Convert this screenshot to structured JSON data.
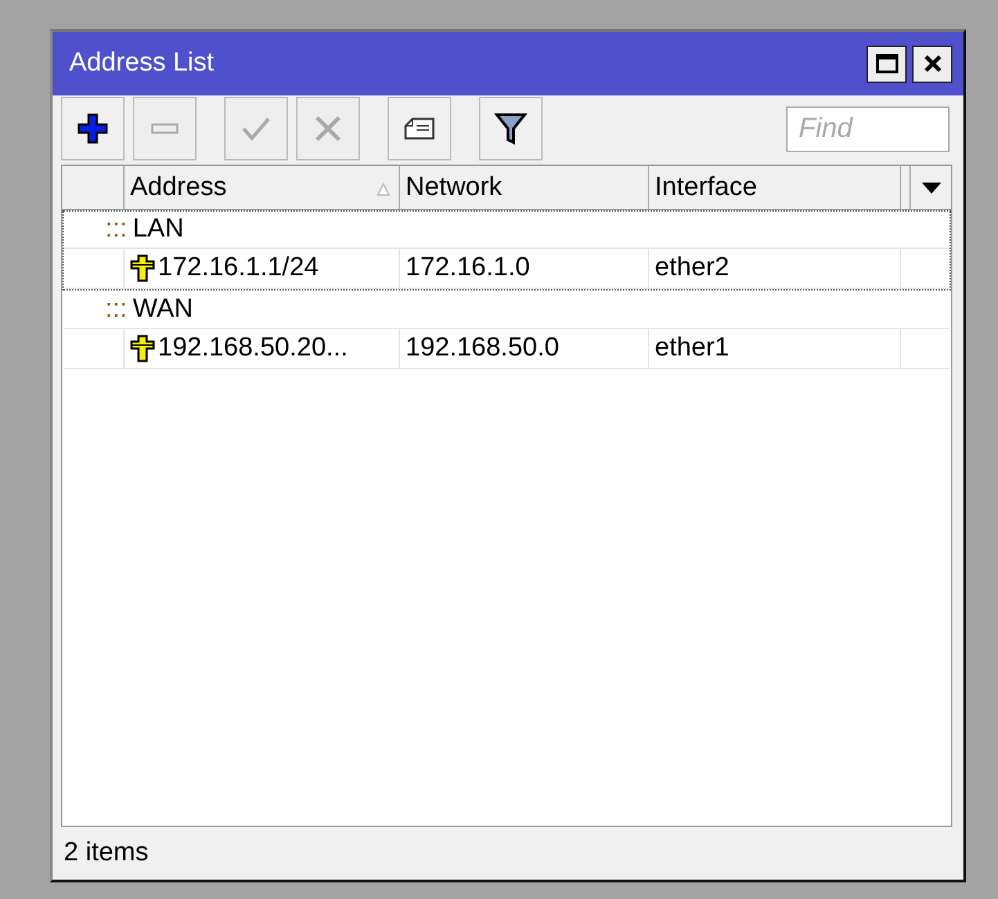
{
  "window": {
    "title": "Address List"
  },
  "toolbar": [
    {
      "kind": "add",
      "disabled": false
    },
    {
      "kind": "remove",
      "disabled": true
    },
    {
      "kind": "enable",
      "disabled": true
    },
    {
      "kind": "disable",
      "disabled": true
    },
    {
      "kind": "comment",
      "disabled": false
    },
    {
      "kind": "filter",
      "disabled": false
    }
  ],
  "search": {
    "placeholder": "Find"
  },
  "table": {
    "columns": [
      {
        "label": "Address",
        "sorted": true
      },
      {
        "label": "Network",
        "sorted": false
      },
      {
        "label": "Interface",
        "sorted": false
      }
    ],
    "groups": [
      {
        "marker": ":::",
        "comment": "LAN",
        "focused": true,
        "rows": [
          {
            "address": "172.16.1.1/24",
            "network": "172.16.1.0",
            "interface": "ether2"
          }
        ]
      },
      {
        "marker": ":::",
        "comment": "WAN",
        "focused": false,
        "rows": [
          {
            "address": "192.168.50.20...",
            "network": "192.168.50.0",
            "interface": "ether1"
          }
        ]
      }
    ]
  },
  "status_bar": "2 items"
}
